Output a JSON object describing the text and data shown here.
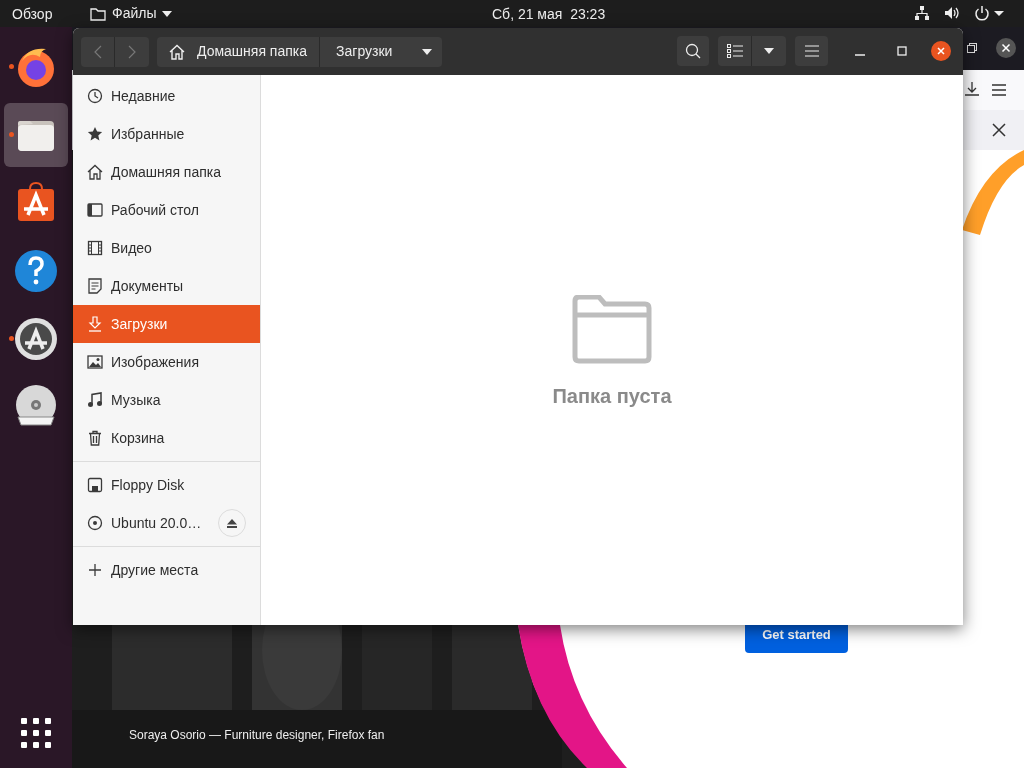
{
  "top_bar": {
    "activities": "Обзор",
    "app_menu": "Файлы",
    "clock": "Сб, 21 мая  23:23"
  },
  "dock": [
    {
      "kind": "browser",
      "running": true,
      "selected": false
    },
    {
      "kind": "files",
      "running": true,
      "selected": true
    },
    {
      "kind": "software",
      "running": false,
      "selected": false
    },
    {
      "kind": "help",
      "running": false,
      "selected": false
    },
    {
      "kind": "updater",
      "running": true,
      "selected": false
    },
    {
      "kind": "dvd",
      "running": false,
      "selected": false
    }
  ],
  "background_browser": {
    "caption": "Soraya Osorio — Furniture designer, Firefox fan",
    "button": "Get started"
  },
  "files_window": {
    "path_bar": [
      {
        "label": "Домашняя папка",
        "kind": "home"
      },
      {
        "label": "Загрузки",
        "kind": "current"
      }
    ],
    "sidebar": [
      [
        {
          "label": "Недавние",
          "kind": "recent",
          "selected": false
        },
        {
          "label": "Избранные",
          "kind": "starred",
          "selected": false
        },
        {
          "label": "Домашняя папка",
          "kind": "home",
          "selected": false
        },
        {
          "label": "Рабочий стол",
          "kind": "desktop",
          "selected": false
        },
        {
          "label": "Видео",
          "kind": "video",
          "selected": false
        },
        {
          "label": "Документы",
          "kind": "documents",
          "selected": false
        },
        {
          "label": "Загрузки",
          "kind": "downloads",
          "selected": true
        },
        {
          "label": "Изображения",
          "kind": "pictures",
          "selected": false
        },
        {
          "label": "Музыка",
          "kind": "music",
          "selected": false
        },
        {
          "label": "Корзина",
          "kind": "trash",
          "selected": false
        }
      ],
      [
        {
          "label": "Floppy Disk",
          "kind": "floppy",
          "selected": false
        },
        {
          "label": "Ubuntu 20.0…",
          "kind": "disc",
          "selected": false,
          "ejectable": true
        }
      ],
      [
        {
          "label": "Другие места",
          "kind": "other",
          "selected": false
        }
      ]
    ],
    "empty_message": "Папка пуста"
  }
}
